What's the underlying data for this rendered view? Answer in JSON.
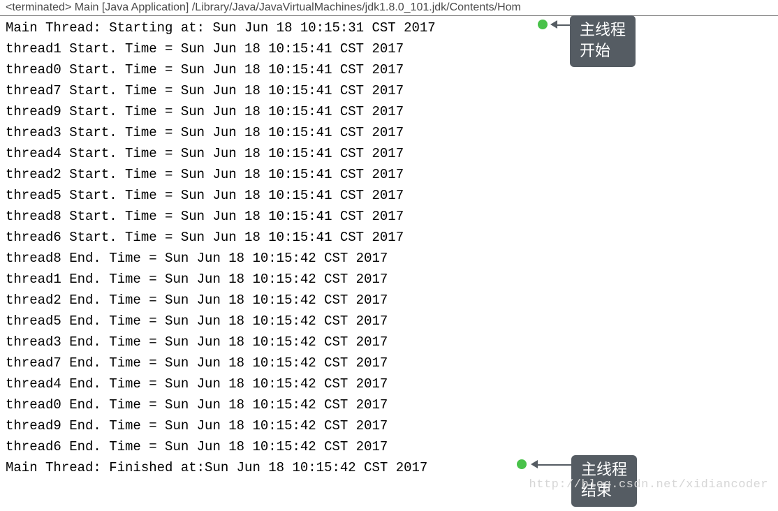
{
  "header": {
    "status": "<terminated>",
    "label": " Main [Java Application] /Library/Java/JavaVirtualMachines/jdk1.8.0_101.jdk/Contents/Hom"
  },
  "console": {
    "lines": [
      "Main Thread: Starting at: Sun Jun 18 10:15:31 CST 2017",
      "thread1 Start. Time = Sun Jun 18 10:15:41 CST 2017",
      "thread0 Start. Time = Sun Jun 18 10:15:41 CST 2017",
      "thread7 Start. Time = Sun Jun 18 10:15:41 CST 2017",
      "thread9 Start. Time = Sun Jun 18 10:15:41 CST 2017",
      "thread3 Start. Time = Sun Jun 18 10:15:41 CST 2017",
      "thread4 Start. Time = Sun Jun 18 10:15:41 CST 2017",
      "thread2 Start. Time = Sun Jun 18 10:15:41 CST 2017",
      "thread5 Start. Time = Sun Jun 18 10:15:41 CST 2017",
      "thread8 Start. Time = Sun Jun 18 10:15:41 CST 2017",
      "thread6 Start. Time = Sun Jun 18 10:15:41 CST 2017",
      "thread8 End. Time = Sun Jun 18 10:15:42 CST 2017",
      "thread1 End. Time = Sun Jun 18 10:15:42 CST 2017",
      "thread2 End. Time = Sun Jun 18 10:15:42 CST 2017",
      "thread5 End. Time = Sun Jun 18 10:15:42 CST 2017",
      "thread3 End. Time = Sun Jun 18 10:15:42 CST 2017",
      "thread7 End. Time = Sun Jun 18 10:15:42 CST 2017",
      "thread4 End. Time = Sun Jun 18 10:15:42 CST 2017",
      "thread0 End. Time = Sun Jun 18 10:15:42 CST 2017",
      "thread9 End. Time = Sun Jun 18 10:15:42 CST 2017",
      "thread6 End. Time = Sun Jun 18 10:15:42 CST 2017",
      "Main Thread: Finished at:Sun Jun 18 10:15:42 CST 2017"
    ]
  },
  "callouts": {
    "top": "主线程\n开始",
    "bottom": "主线程\n结束"
  },
  "watermark": "http://blog.csdn.net/xidiancoder"
}
